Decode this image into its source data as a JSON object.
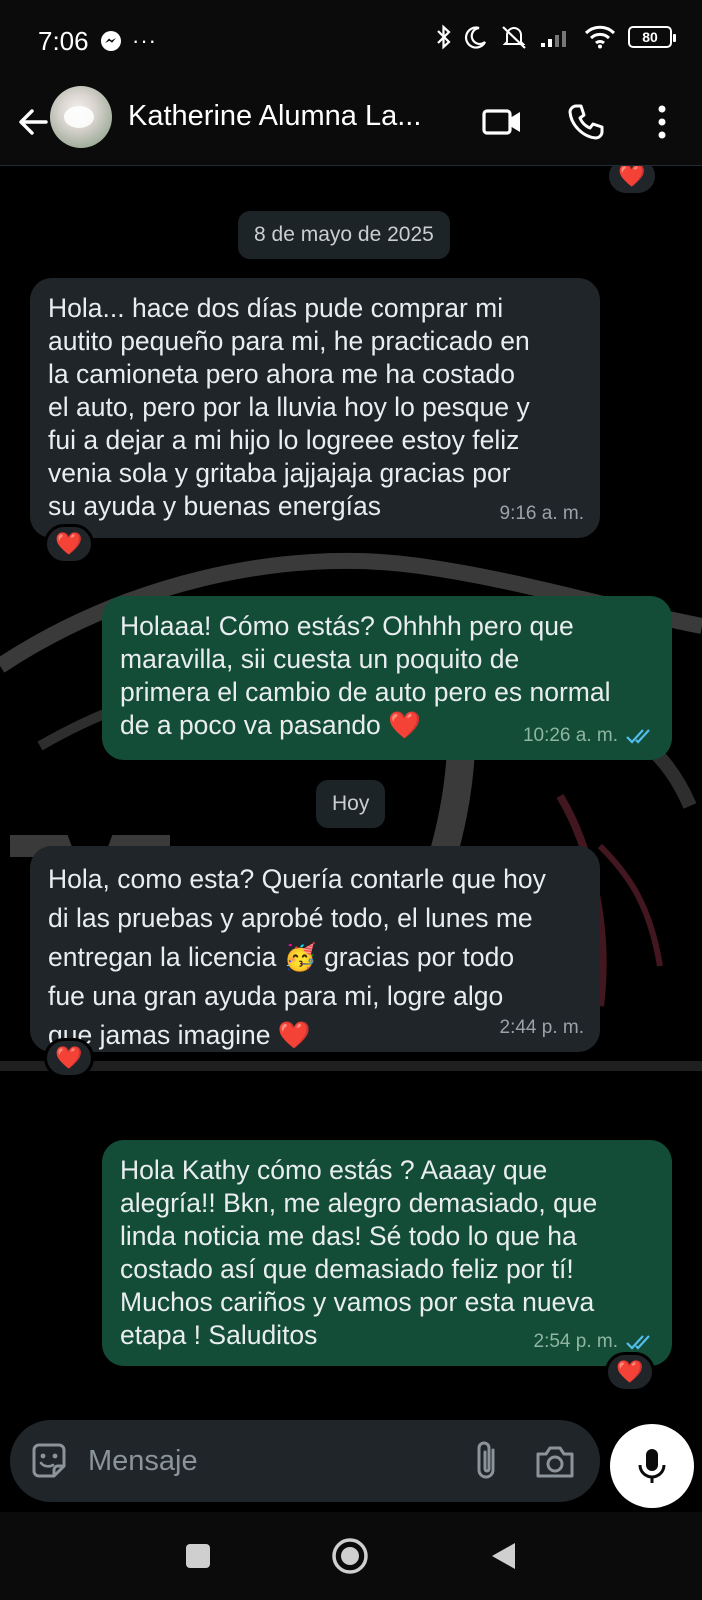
{
  "status_bar": {
    "time": "7:06",
    "battery": "80"
  },
  "header": {
    "contact_name": "Katherine Alumna La..."
  },
  "chat": {
    "date_separator_1": "8 de mayo de 2025",
    "date_separator_2": "Hoy",
    "messages": [
      {
        "direction": "in",
        "text": "Hola... hace dos días pude comprar mi\nautito pequeño para mi, he practicado en\nla camioneta pero ahora me ha costado\nel auto, pero por la lluvia hoy lo pesque y\nfui a dejar a mi hijo lo logreee estoy feliz\nvenia sola y gritaba jajjajaja gracias por\nsu ayuda y buenas energías",
        "time": "9:16 a. m.",
        "reaction": "❤️"
      },
      {
        "direction": "out",
        "text": "Holaaa! Cómo estás? Ohhhh pero que\nmaravilla, sii cuesta un poquito de\nprimera el cambio de auto pero es normal\nde a poco va pasando ❤️",
        "time": "10:26 a. m."
      },
      {
        "direction": "in",
        "text": "Hola, como esta? Quería contarle que hoy\ndi las pruebas y aprobé todo, el lunes me\nentregan la licencia 🥳 gracias por todo\nfue una gran ayuda para mi, logre algo\nque jamas imagine ❤️",
        "time": "2:44 p. m.",
        "reaction": "❤️"
      },
      {
        "direction": "out",
        "text": "Hola Kathy cómo estás ? Aaaay que\nalegría!! Bkn, me alegro demasiado, que\nlinda noticia me das! Sé todo lo que ha\ncostado así que demasiado feliz por tí!\nMuchos cariños y vamos por esta nueva\netapa ! Saluditos",
        "time": "2:54 p. m.",
        "reaction": "❤️"
      }
    ],
    "top_reaction": "❤️"
  },
  "composer": {
    "placeholder": "Mensaje"
  },
  "colors": {
    "incoming_bubble": "#1f2529",
    "outgoing_bubble": "#134d37",
    "read_ticks": "#53bdeb"
  }
}
